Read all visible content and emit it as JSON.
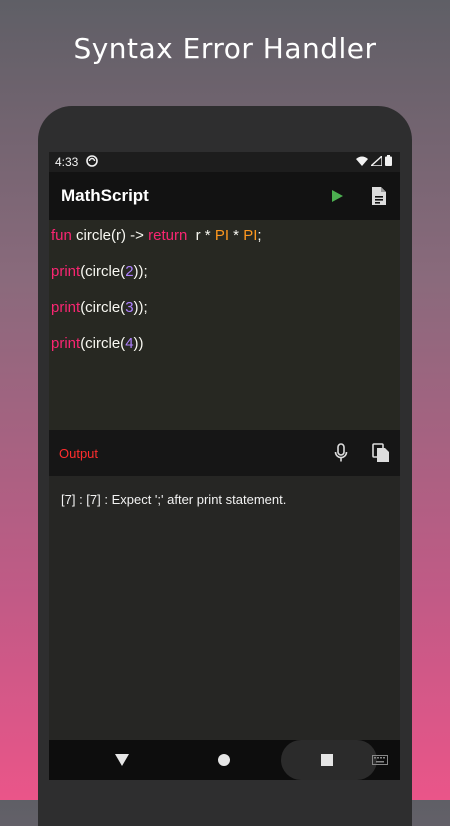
{
  "banner": {
    "title": "Syntax Error Handler"
  },
  "status": {
    "time": "4:33"
  },
  "app": {
    "title": "MathScript"
  },
  "editor": {
    "line1": {
      "kw1": "fun",
      "t1": " circle(r) -> ",
      "kw2": "return",
      "t2": "  r * ",
      "c1": "PI",
      "t3": " * ",
      "c2": "PI",
      "t4": ";"
    },
    "line2": {
      "kw": "print",
      "t1": "(circle(",
      "num": "2",
      "t2": "));"
    },
    "line3": {
      "kw": "print",
      "t1": "(circle(",
      "num": "3",
      "t2": "));"
    },
    "line4": {
      "kw": "print",
      "t1": "(circle(",
      "num": "4",
      "t2": "))"
    }
  },
  "output": {
    "label": "Output",
    "message": "[7] : [7] : Expect ';' after print statement."
  },
  "colors": {
    "keyword": "#f92672",
    "number": "#ae81ff",
    "constant": "#fd971f",
    "error_label": "#ff2d2d",
    "run_icon": "#4caf50"
  },
  "icons": {
    "run": "play-icon",
    "doc": "document-icon",
    "mic": "microphone-icon",
    "copy": "copy-icon",
    "back": "nav-back-icon",
    "home": "nav-home-icon",
    "recents": "nav-recents-icon",
    "keyboard": "keyboard-icon"
  }
}
